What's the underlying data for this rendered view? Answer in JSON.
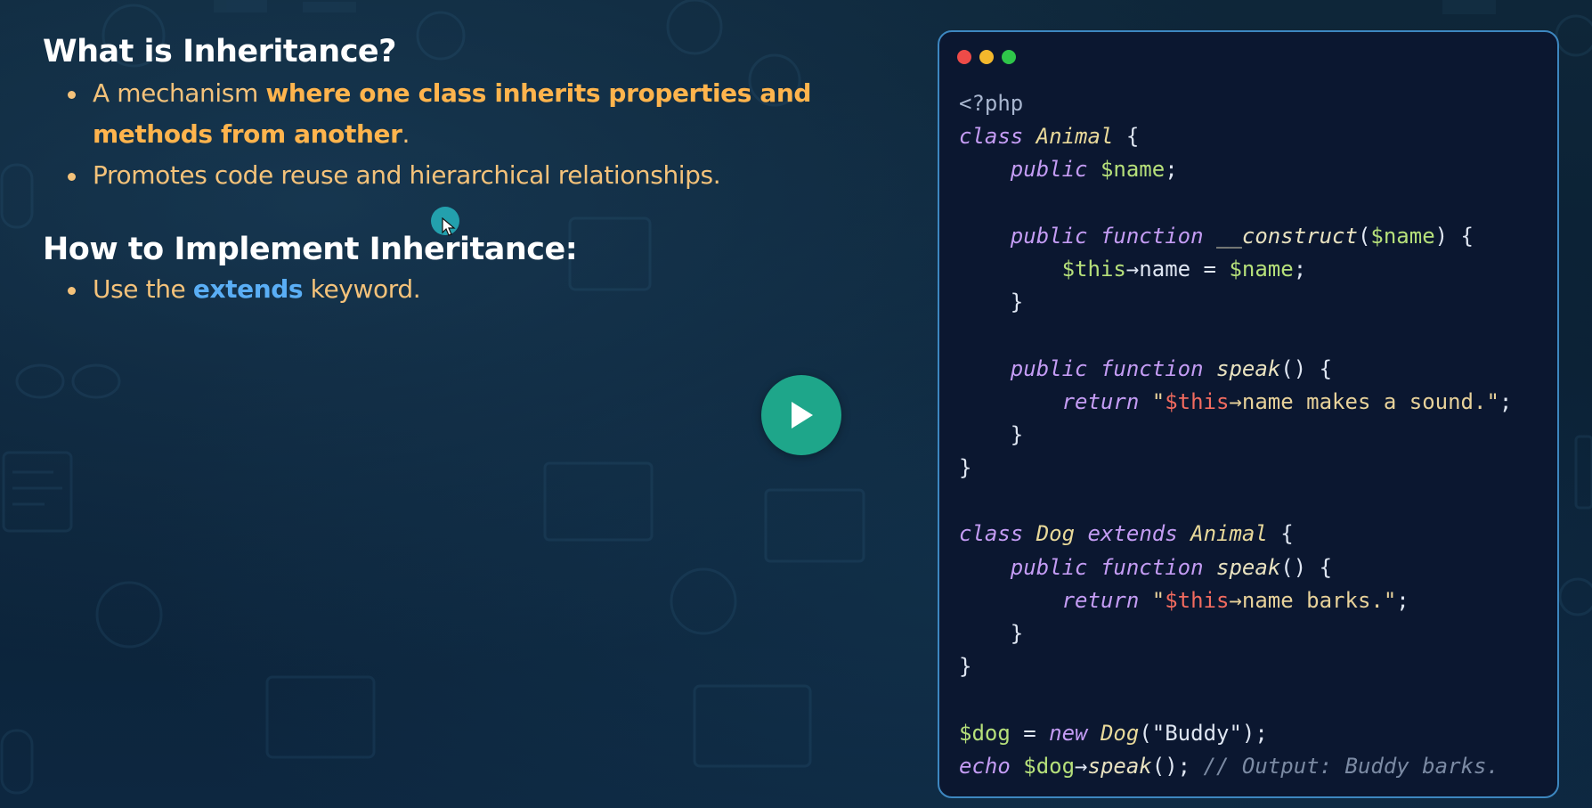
{
  "slide": {
    "heading1": "What is Inheritance?",
    "bullet1": {
      "prefix": "A mechanism ",
      "emphasis": "where one class inherits properties and methods from another",
      "suffix": "."
    },
    "bullet2": "Promotes code reuse and hierarchical relationships.",
    "heading2": "How to Implement Inheritance:",
    "bullet3": {
      "prefix": "Use the ",
      "keyword": "extends",
      "suffix": " keyword."
    }
  },
  "colors": {
    "accent_orange": "#ffb44d",
    "accent_blue": "#5aaef5",
    "play_button": "#1ea68a",
    "code_border": "#3d87c0"
  },
  "icons": [
    "play-icon",
    "cursor-icon",
    "window-close-dot",
    "window-minimize-dot",
    "window-maximize-dot"
  ],
  "code_lines": [
    [
      [
        "meta",
        "<?php"
      ]
    ],
    [
      [
        "kw",
        "class"
      ],
      [
        "plain",
        " "
      ],
      [
        "cls",
        "Animal"
      ],
      [
        "plain",
        " {"
      ]
    ],
    [
      [
        "plain",
        "    "
      ],
      [
        "kw",
        "public"
      ],
      [
        "plain",
        " "
      ],
      [
        "var",
        "$name"
      ],
      [
        "plain",
        ";"
      ]
    ],
    [],
    [
      [
        "plain",
        "    "
      ],
      [
        "kw",
        "public"
      ],
      [
        "plain",
        " "
      ],
      [
        "kw",
        "function"
      ],
      [
        "plain",
        " "
      ],
      [
        "fn",
        "__construct"
      ],
      [
        "plain",
        "("
      ],
      [
        "var",
        "$name"
      ],
      [
        "plain",
        ") {"
      ]
    ],
    [
      [
        "plain",
        "        "
      ],
      [
        "var",
        "$this"
      ],
      [
        "plain",
        "→name = "
      ],
      [
        "var",
        "$name"
      ],
      [
        "plain",
        ";"
      ]
    ],
    [
      [
        "plain",
        "    }"
      ]
    ],
    [],
    [
      [
        "plain",
        "    "
      ],
      [
        "kw",
        "public"
      ],
      [
        "plain",
        " "
      ],
      [
        "kw",
        "function"
      ],
      [
        "plain",
        " "
      ],
      [
        "fn",
        "speak"
      ],
      [
        "plain",
        "() {"
      ]
    ],
    [
      [
        "plain",
        "        "
      ],
      [
        "kw",
        "return"
      ],
      [
        "plain",
        " "
      ],
      [
        "str",
        "\""
      ],
      [
        "strvar",
        "$this"
      ],
      [
        "str",
        "→name makes a sound.\""
      ],
      [
        "plain",
        ";"
      ]
    ],
    [
      [
        "plain",
        "    }"
      ]
    ],
    [
      [
        "plain",
        "}"
      ]
    ],
    [],
    [
      [
        "kw",
        "class"
      ],
      [
        "plain",
        " "
      ],
      [
        "cls",
        "Dog"
      ],
      [
        "plain",
        " "
      ],
      [
        "kw",
        "extends"
      ],
      [
        "plain",
        " "
      ],
      [
        "cls",
        "Animal"
      ],
      [
        "plain",
        " {"
      ]
    ],
    [
      [
        "plain",
        "    "
      ],
      [
        "kw",
        "public"
      ],
      [
        "plain",
        " "
      ],
      [
        "kw",
        "function"
      ],
      [
        "plain",
        " "
      ],
      [
        "fn",
        "speak"
      ],
      [
        "plain",
        "() {"
      ]
    ],
    [
      [
        "plain",
        "        "
      ],
      [
        "kw",
        "return"
      ],
      [
        "plain",
        " "
      ],
      [
        "str",
        "\""
      ],
      [
        "strvar",
        "$this"
      ],
      [
        "str",
        "→name barks.\""
      ],
      [
        "plain",
        ";"
      ]
    ],
    [
      [
        "plain",
        "    }"
      ]
    ],
    [
      [
        "plain",
        "}"
      ]
    ],
    [],
    [
      [
        "var",
        "$dog"
      ],
      [
        "plain",
        " = "
      ],
      [
        "kw",
        "new"
      ],
      [
        "plain",
        " "
      ],
      [
        "cls",
        "Dog"
      ],
      [
        "plain",
        "(\"Buddy\");"
      ]
    ],
    [
      [
        "kw",
        "echo"
      ],
      [
        "plain",
        " "
      ],
      [
        "var",
        "$dog"
      ],
      [
        "plain",
        "→"
      ],
      [
        "fn",
        "speak"
      ],
      [
        "plain",
        "(); "
      ],
      [
        "cmt",
        "// Output: Buddy barks."
      ]
    ]
  ]
}
